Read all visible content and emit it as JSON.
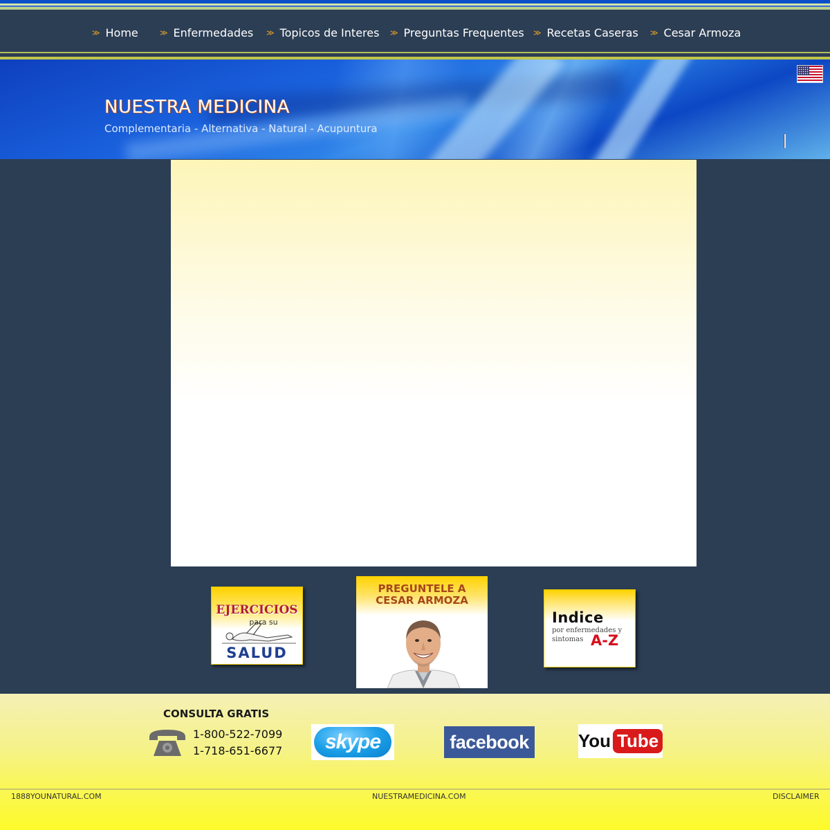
{
  "nav": {
    "items": [
      {
        "label": "Home"
      },
      {
        "label": "Enfermedades"
      },
      {
        "label": "Topicos de Interes"
      },
      {
        "label": "Preguntas Frequentes"
      },
      {
        "label": "Recetas Caseras"
      },
      {
        "label": "Cesar Armoza"
      }
    ],
    "bullet": "≫"
  },
  "banner": {
    "title": "NUESTRA MEDICINA",
    "subtitle": "Complementaria - Alternativa - Natural - Acupuntura",
    "flag_icon": "us-flag-icon"
  },
  "promos": {
    "ejercicios": {
      "title": "EJERCICIOS",
      "sub": "para su",
      "salud": "SALUD"
    },
    "pregunte": {
      "line1": "PREGUNTELE A",
      "line2": "CESAR ARMOZA"
    },
    "indice": {
      "title": "Indice",
      "sub1": "por enfermedades y",
      "sub2": "sintomas",
      "az": "A-Z"
    }
  },
  "footer": {
    "consulta": "CONSULTA GRATIS",
    "phone1": "1-800-522-7099",
    "phone2": "1-718-651-6677",
    "skype": "skype",
    "facebook": "facebook",
    "youtube_you": "You",
    "youtube_tube": "Tube",
    "link_left": "1888YOUNATURAL.COM",
    "link_center": "NUESTRAMEDICINA.COM",
    "link_right": "DISCLAIMER"
  },
  "colors": {
    "background": "#2c3e54",
    "nav_bullet": "#f0a41e",
    "accent_line": "#b8c05a",
    "facebook": "#3b5998",
    "youtube_red": "#d91a1a",
    "footer_yellow": "#faf755"
  }
}
